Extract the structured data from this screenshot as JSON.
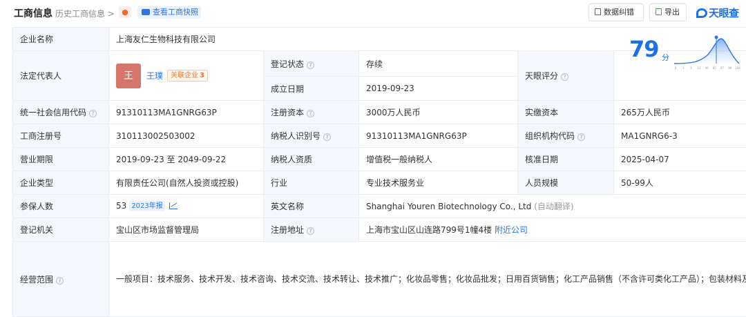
{
  "header": {
    "title": "工商信息",
    "history": "历史工商信息 >",
    "snapshot_label": "查看工商快照",
    "feedback_label": "数据纠错",
    "export_label": "导出",
    "brand": "天眼查"
  },
  "rows": {
    "company_name": {
      "key": "企业名称",
      "value": "上海友仁生物科技有限公司"
    },
    "legal_rep": {
      "key": "法定代表人",
      "avatar": "王",
      "name": "王璞",
      "related_label": "关联企业",
      "related_count": "3"
    },
    "reg_status": {
      "key": "登记状态",
      "value": "存续"
    },
    "est_date": {
      "key": "成立日期",
      "value": "2019-09-23"
    },
    "score": {
      "key": "天眼评分",
      "value": "79",
      "unit": "分",
      "axis_ticks": [
        "0",
        "1",
        "2",
        "13",
        "40",
        "85",
        "97",
        "99",
        "100"
      ]
    },
    "credit_code": {
      "key": "统一社会信用代码",
      "value": "91310113MA1GNRG63P"
    },
    "reg_capital": {
      "key": "注册资本",
      "value": "3000万人民币"
    },
    "paid_capital": {
      "key": "实缴资本",
      "value": "265万人民币"
    },
    "reg_no": {
      "key": "工商注册号",
      "value": "310113002503002"
    },
    "taxpayer_id": {
      "key": "纳税人识别号",
      "value": "91310113MA1GNRG63P"
    },
    "org_code": {
      "key": "组织机构代码",
      "value": "MA1GNRG6-3"
    },
    "period": {
      "key": "营业期限",
      "value": "2019-09-23 至 2049-09-22"
    },
    "taxpayer_type": {
      "key": "纳税人资质",
      "value": "增值税一般纳税人"
    },
    "approve_date": {
      "key": "核准日期",
      "value": "2025-04-07"
    },
    "company_type": {
      "key": "企业类型",
      "value": "有限责任公司(自然人投资或控股)"
    },
    "industry": {
      "key": "行业",
      "value": "专业技术服务业"
    },
    "staff_size": {
      "key": "人员规模",
      "value": "50-99人"
    },
    "insured": {
      "key": "参保人数",
      "value": "53",
      "tag": "2023年报"
    },
    "english_name": {
      "key": "英文名称",
      "value": "Shanghai Youren Biotechnology Co., Ltd",
      "note": "(自动翻译)"
    },
    "authority": {
      "key": "登记机关",
      "value": "宝山区市场监督管理局"
    },
    "address": {
      "key": "注册地址",
      "value": "上海市宝山区山连路799号1幢4楼",
      "link": "附近公司"
    },
    "scope": {
      "key": "经营范围",
      "value": "一般项目：技术服务、技术开发、技术咨询、技术交流、技术转让、技术推广；化妆品零售；化妆品批发；日用百货销售；化工产品销售（不含许可类化工产品）；包装材料及制品销售；市场营销策划；品牌管理；普通货物仓储服务（不含危险化学品等需许可审批的项目）；传统香料制品经营；日用化学产品制造；日用化学产品销售；卫生用品和一次性使用医疗用品销售；信息咨询服务（不含许可类信息咨询服务）；第一类医疗器械销售；第二类医疗器械销售；货物进出口；技术进出口。（除依法须经批准的项目外，凭营业执照依法自主开展经营活动）许可项目：化妆品生产。（依法须经批准的项目，经相关部门批准后方可开展经营活动，具体经营项目以相关部门批准文件或许可证件为准）"
    }
  },
  "colors": {
    "accent": "#2d74e7",
    "status_green": "#2aa34a",
    "key_bg": "#f4f7fb"
  }
}
